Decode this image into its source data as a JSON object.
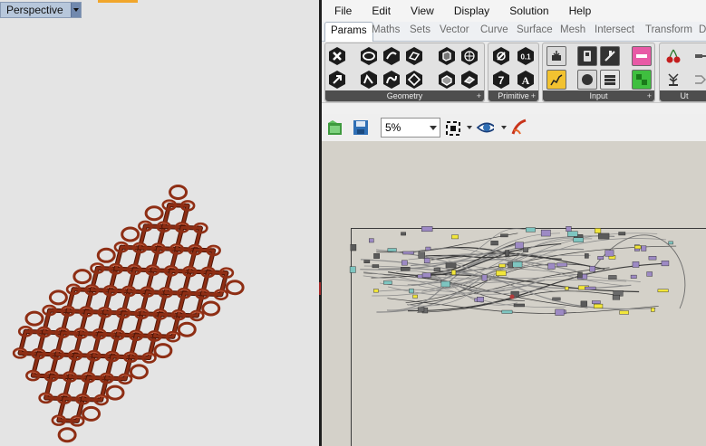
{
  "viewport": {
    "name": "Perspective",
    "mesh_color": "#8e2e14"
  },
  "grasshopper": {
    "menu": [
      "File",
      "Edit",
      "View",
      "Display",
      "Solution",
      "Help"
    ],
    "tabs": [
      "Params",
      "Maths",
      "Sets",
      "Vector",
      "Curve",
      "Surface",
      "Mesh",
      "Intersect",
      "Transform",
      "D"
    ],
    "active_tab": "Params",
    "ribbon_panels": [
      {
        "label": "Geometry"
      },
      {
        "label": "Primitive"
      },
      {
        "label": "Input"
      },
      {
        "label": "Ut"
      }
    ],
    "primitive_glyphs": [
      "0.1",
      "7",
      "A"
    ],
    "zoom": "5%",
    "canvas_bg": "#d4d1c9"
  }
}
